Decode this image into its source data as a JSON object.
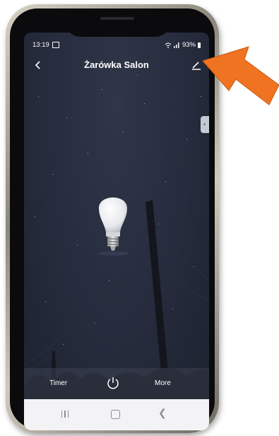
{
  "status_bar": {
    "time": "13:19",
    "battery": "93%"
  },
  "header": {
    "back_icon": "chevron-left-icon",
    "title": "Żarówka Salon",
    "edit_icon": "pencil-icon"
  },
  "device": {
    "image": "light-bulb-icon"
  },
  "bottom_bar": {
    "timer_label": "Timer",
    "power_icon": "power-icon",
    "more_label": "More"
  },
  "navigation": {
    "recent_icon": "recent-apps-icon",
    "home_icon": "home-icon",
    "back_icon": "back-icon"
  },
  "colors": {
    "annotation_arrow": "#f07321",
    "app_background": "#262c3d",
    "nav_background": "#f3f3f5"
  }
}
